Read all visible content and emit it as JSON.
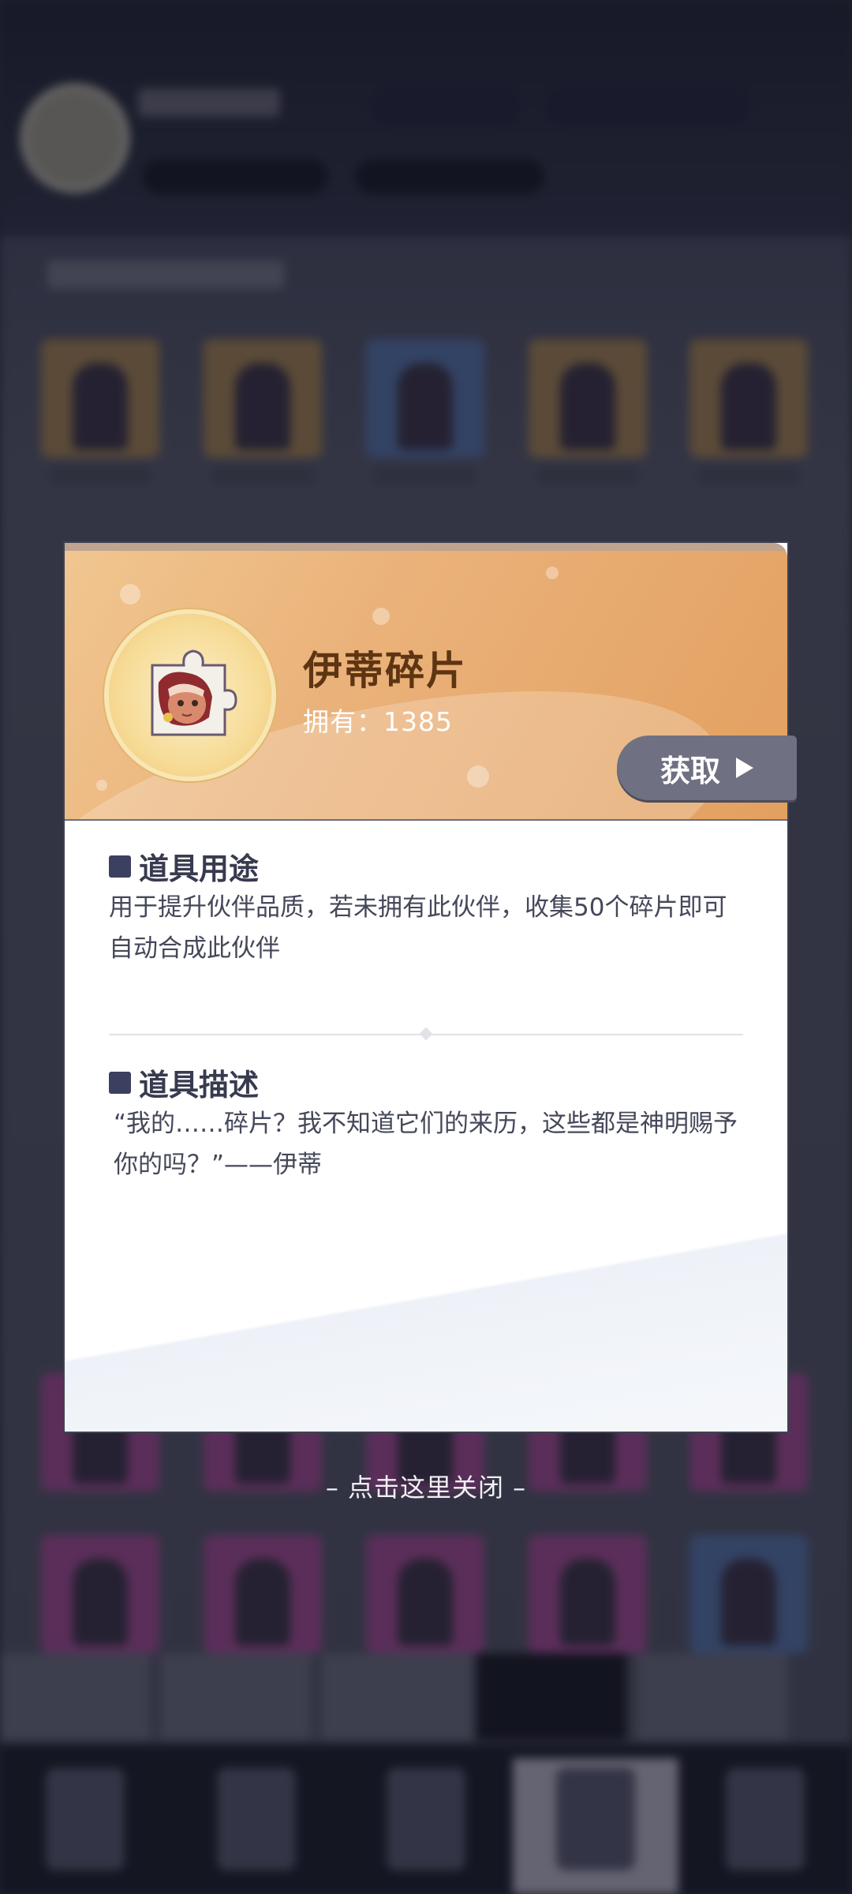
{
  "dialog": {
    "item_name": "伊蒂碎片",
    "owned_label": "拥有：1385",
    "get_button_label": "获取",
    "usage_title": "道具用途",
    "usage_text": "用于提升伙伴品质，若未拥有此伙伴，收集50个碎片即可自动合成此伙伴",
    "description_title": "道具描述",
    "description_text": "“我的……碎片？我不知道它们的来历，这些都是神明赐予你的吗？”——伊蒂",
    "item_icon": "puzzle-fragment-portrait-icon"
  },
  "close_hint": "– 点击这里关闭 –",
  "colors": {
    "header_gradient_start": "#f1c690",
    "header_gradient_end": "#e3a060",
    "item_name": "#5e3512",
    "get_button": "#6f7182",
    "section_title": "#383b4f",
    "body_text": "#45485a"
  }
}
